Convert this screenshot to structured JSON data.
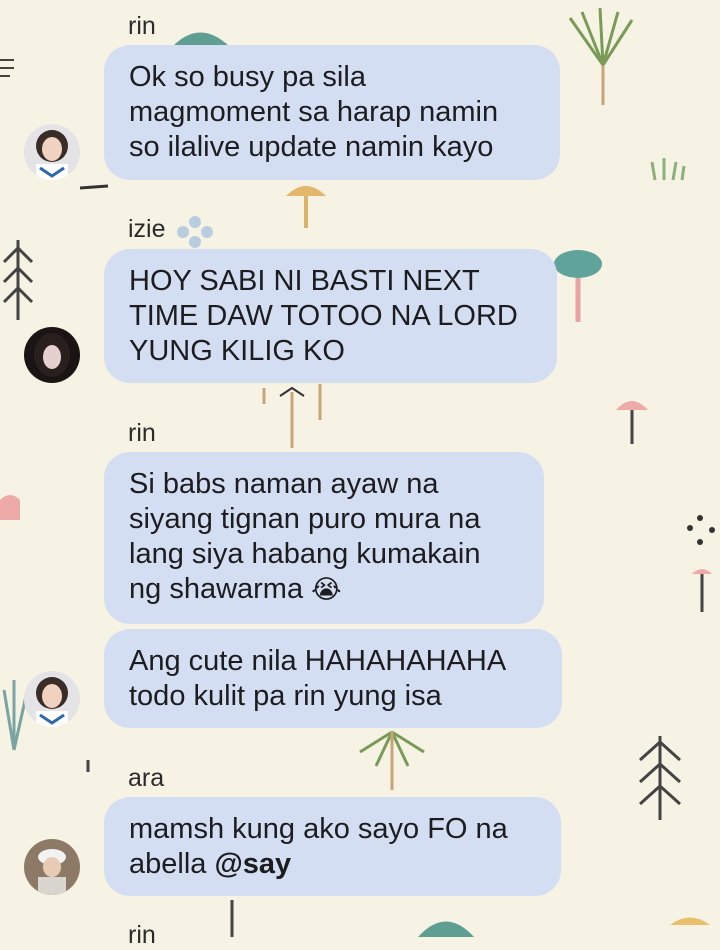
{
  "messages": [
    {
      "sender": "rin",
      "lines": [
        "Ok so busy pa sila",
        "magmoment sa harap namin",
        "so ilalive update namin kayo"
      ]
    },
    {
      "sender": "izie",
      "lines": [
        "HOY SABI NI BASTI NEXT",
        "TIME DAW TOTOO NA LORD",
        "YUNG KILIG KO"
      ]
    },
    {
      "sender": "rin",
      "lines": [
        "Si babs naman ayaw na",
        "siyang tignan puro mura na",
        "lang siya habang kumakain",
        "ng shawarma"
      ],
      "emoji": "😭"
    },
    {
      "lines": [
        "Ang cute nila HAHAHAHAHA",
        "todo kulit pa rin yung isa"
      ]
    },
    {
      "sender": "ara",
      "lines": [
        "mamsh kung ako sayo FO na",
        "abella"
      ],
      "mention": "@say"
    },
    {
      "sender": "rin"
    }
  ],
  "colors": {
    "background": "#f7f3e4",
    "bubble": "#d4def3",
    "text": "#1d1d1f"
  },
  "icons": [
    "avatar-rin",
    "avatar-izie",
    "avatar-ara"
  ]
}
